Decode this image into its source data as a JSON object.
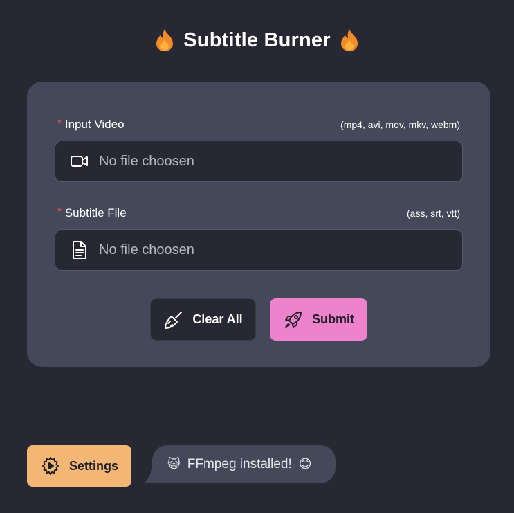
{
  "header": {
    "title": "Subtitle Burner",
    "left_icon": "flame-icon",
    "right_icon": "flame-icon",
    "flame_color": "#f28c28"
  },
  "form": {
    "video": {
      "required_mark": "*",
      "label": "Input Video",
      "hint": "(mp4, avi, mov, mkv, webm)",
      "icon": "video-camera-icon",
      "placeholder": "No file choosen"
    },
    "subtitle": {
      "required_mark": "*",
      "label": "Subtitle File",
      "hint": "(ass, srt, vtt)",
      "icon": "document-icon",
      "placeholder": "No file choosen"
    },
    "actions": {
      "clear_label": "Clear All",
      "clear_icon": "broom-icon",
      "submit_label": "Submit",
      "submit_icon": "rocket-icon",
      "submit_color": "#ee82cc"
    }
  },
  "footer": {
    "settings_label": "Settings",
    "settings_icon": "settings-play-icon",
    "settings_color": "#f3b674",
    "status_emoji_left": "😺",
    "status_text": "FFmpeg installed!",
    "status_emoji_right": "😊"
  },
  "colors": {
    "background": "#282834",
    "card": "#454858",
    "required": "#ef5350"
  }
}
